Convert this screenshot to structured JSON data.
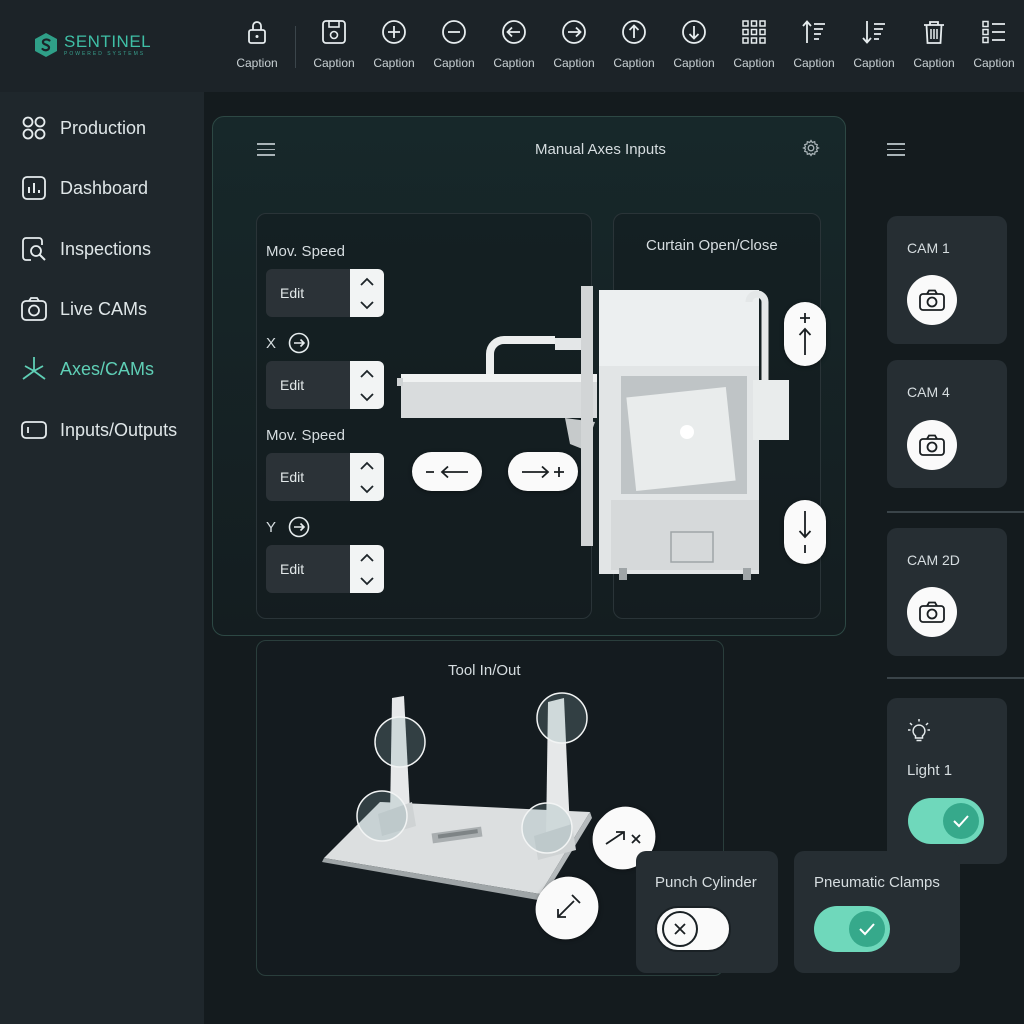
{
  "app": {
    "brand": "SENTINEL",
    "tagline": "POWERED SYSTEMS"
  },
  "toolbar": {
    "buttons": [
      {
        "icon": "lock-icon",
        "caption": "Caption"
      },
      {
        "icon": "save-icon",
        "caption": "Caption"
      },
      {
        "icon": "plus-circle-icon",
        "caption": "Caption"
      },
      {
        "icon": "minus-circle-icon",
        "caption": "Caption"
      },
      {
        "icon": "arrow-left-circle-icon",
        "caption": "Caption"
      },
      {
        "icon": "arrow-right-circle-icon",
        "caption": "Caption"
      },
      {
        "icon": "arrow-up-circle-icon",
        "caption": "Caption"
      },
      {
        "icon": "arrow-down-circle-icon",
        "caption": "Caption"
      },
      {
        "icon": "grid-icon",
        "caption": "Caption"
      },
      {
        "icon": "sort-ascending-icon",
        "caption": "Caption"
      },
      {
        "icon": "sort-descending-icon",
        "caption": "Caption"
      },
      {
        "icon": "trash-icon",
        "caption": "Caption"
      },
      {
        "icon": "checklist-icon",
        "caption": "Caption"
      }
    ]
  },
  "sidebar": {
    "items": [
      {
        "icon": "production-icon",
        "label": "Production"
      },
      {
        "icon": "dashboard-icon",
        "label": "Dashboard"
      },
      {
        "icon": "inspections-icon",
        "label": "Inspections"
      },
      {
        "icon": "camera-icon",
        "label": "Live CAMs"
      },
      {
        "icon": "axes-icon",
        "label": "Axes/CAMs",
        "active": true
      },
      {
        "icon": "io-icon",
        "label": "Inputs/Outputs"
      }
    ]
  },
  "manual_axes": {
    "title": "Manual Axes Inputs",
    "controls": {
      "speed_label_1": "Mov. Speed",
      "x_label": "X",
      "speed_label_2": "Mov. Speed",
      "y_label": "Y",
      "edit_text": "Edit"
    },
    "curtain": {
      "title": "Curtain Open/Close"
    },
    "tool": {
      "title": "Tool In/Out"
    }
  },
  "cameras": [
    {
      "label": "CAM 1"
    },
    {
      "label": "CAM 4"
    },
    {
      "label": "CAM 2D"
    }
  ],
  "light": {
    "label": "Light 1",
    "on": true
  },
  "punch_cylinder": {
    "label": "Punch Cylinder",
    "on": false
  },
  "pneumatic_clamps": {
    "label": "Pneumatic Clamps",
    "on": true
  },
  "colors": {
    "accent": "#5fcfb6",
    "toggle_on": "#6fd8bb",
    "background": "#141b1e",
    "sidebar": "#1f272c"
  }
}
